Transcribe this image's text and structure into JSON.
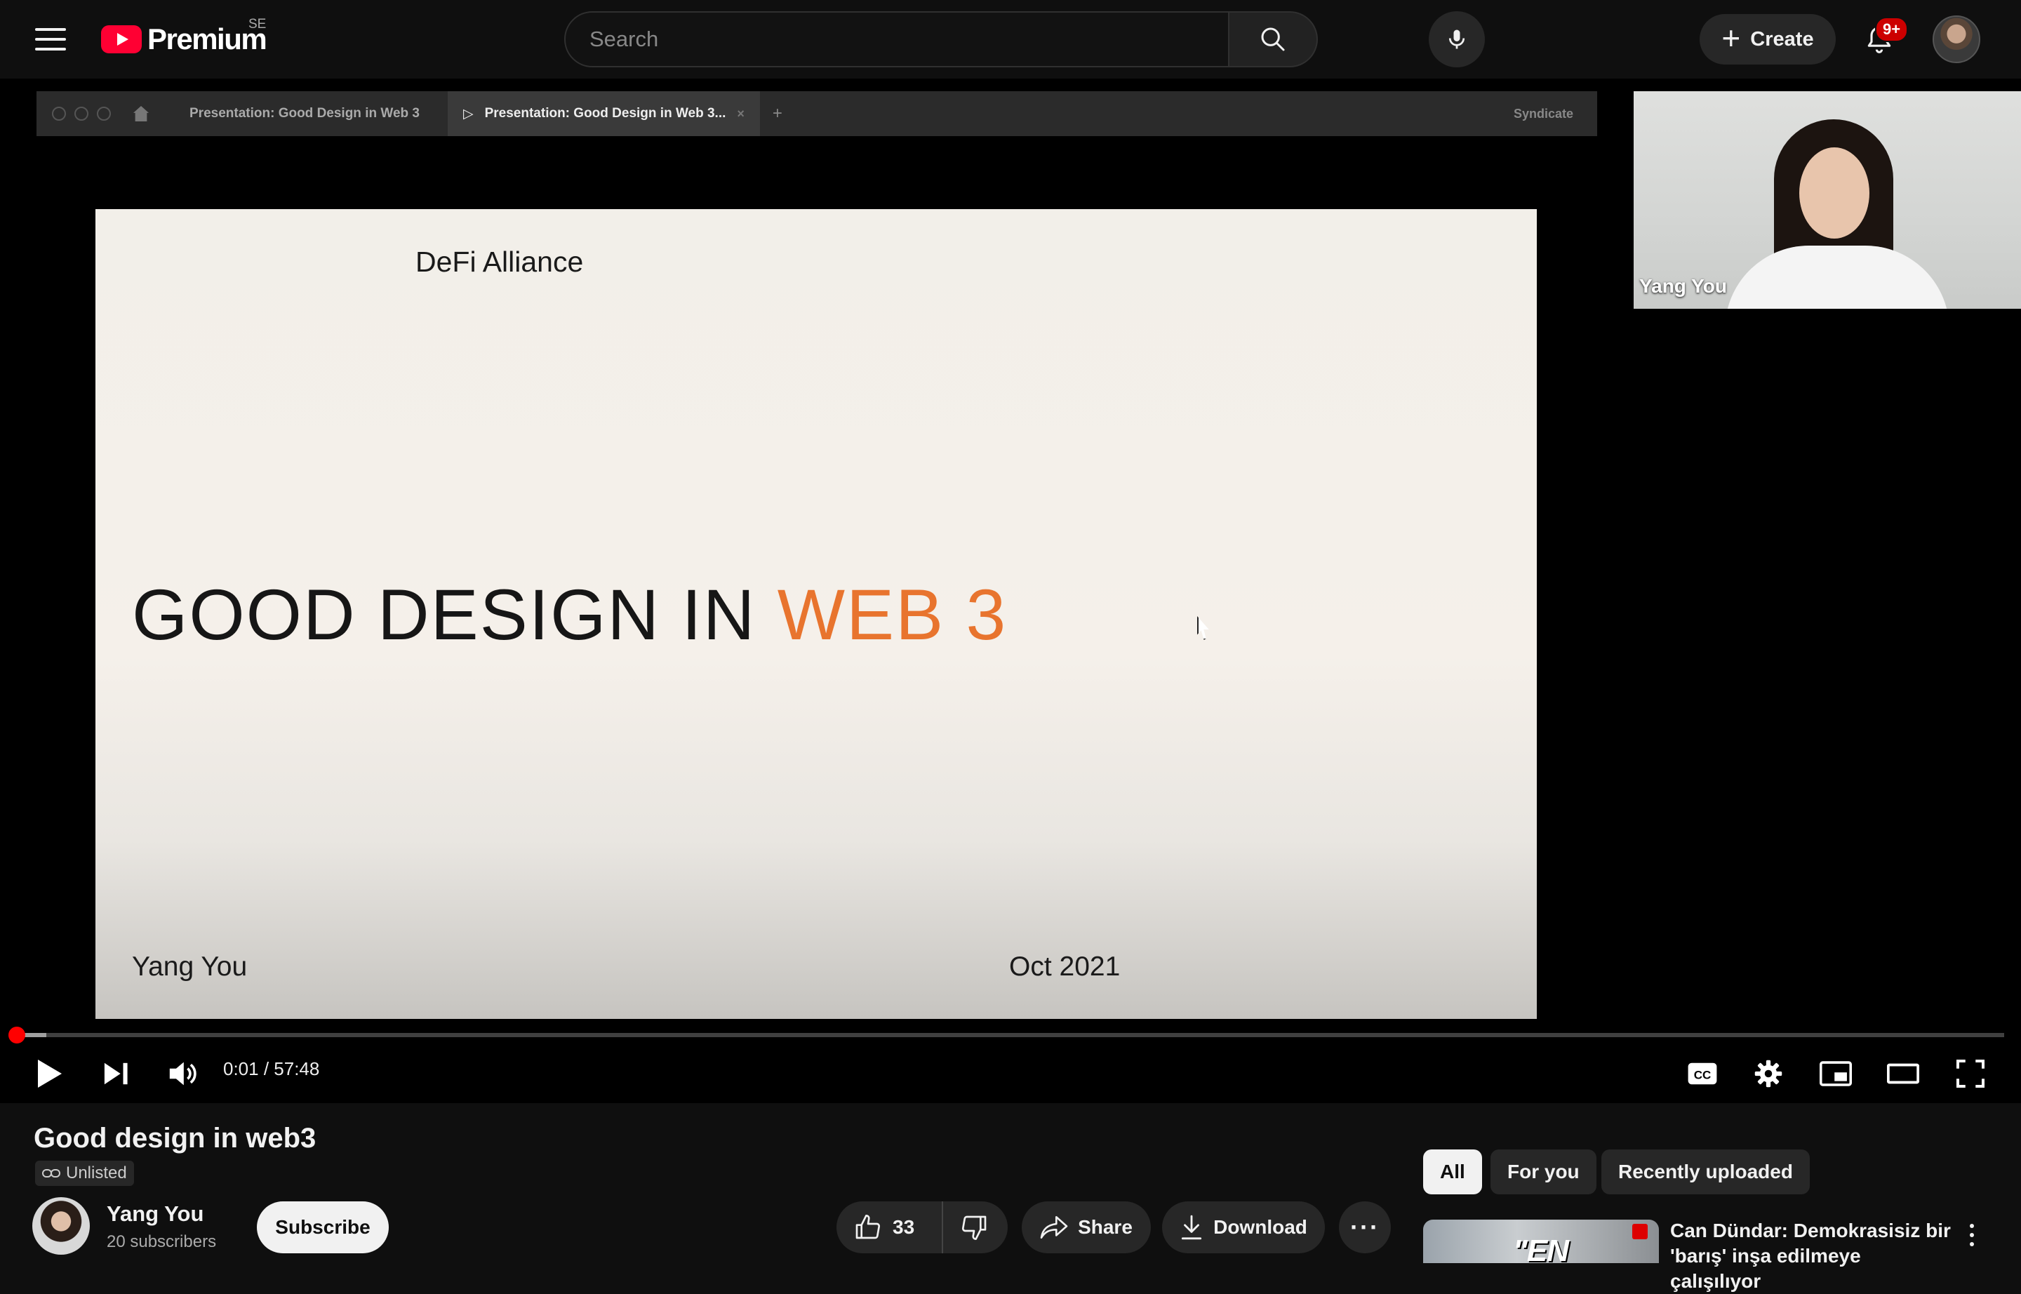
{
  "header": {
    "logo_text": "Premium",
    "region": "SE",
    "search_placeholder": "Search",
    "create_label": "Create",
    "notifications_badge": "9+"
  },
  "player": {
    "browser_tabs": [
      "Presentation: Good Design in Web 3",
      "Presentation: Good Design in Web 3..."
    ],
    "browser_right_label": "Syndicate",
    "slide": {
      "org": "DeFi Alliance",
      "title_part1": "GOOD DESIGN IN",
      "title_part2": "WEB 3",
      "author": "Yang You",
      "date": "Oct 2021"
    },
    "webcam_name": "Yang You",
    "time_display": "0:01 / 57:48",
    "progress_fraction": 0.0003,
    "buffered_fraction": 0.015
  },
  "video": {
    "title": "Good design in web3",
    "visibility": "Unlisted",
    "channel_name": "Yang You",
    "subscribers": "20 subscribers",
    "subscribe_label": "Subscribe",
    "likes": "33",
    "share_label": "Share",
    "download_label": "Download"
  },
  "sidebar": {
    "chips": [
      {
        "label": "All",
        "selected": true
      },
      {
        "label": "For you",
        "selected": false
      },
      {
        "label": "Recently uploaded",
        "selected": false
      }
    ],
    "rec_thumb_text": "\"EN BÜYÜK",
    "rec_title": "Can Dündar: Demokrasisiz bir 'barış' inşa edilmeye çalışılıyor"
  },
  "colors": {
    "brand_red": "#ff0033",
    "slide_accent": "#e8742e",
    "progress_red": "#ff0000"
  }
}
